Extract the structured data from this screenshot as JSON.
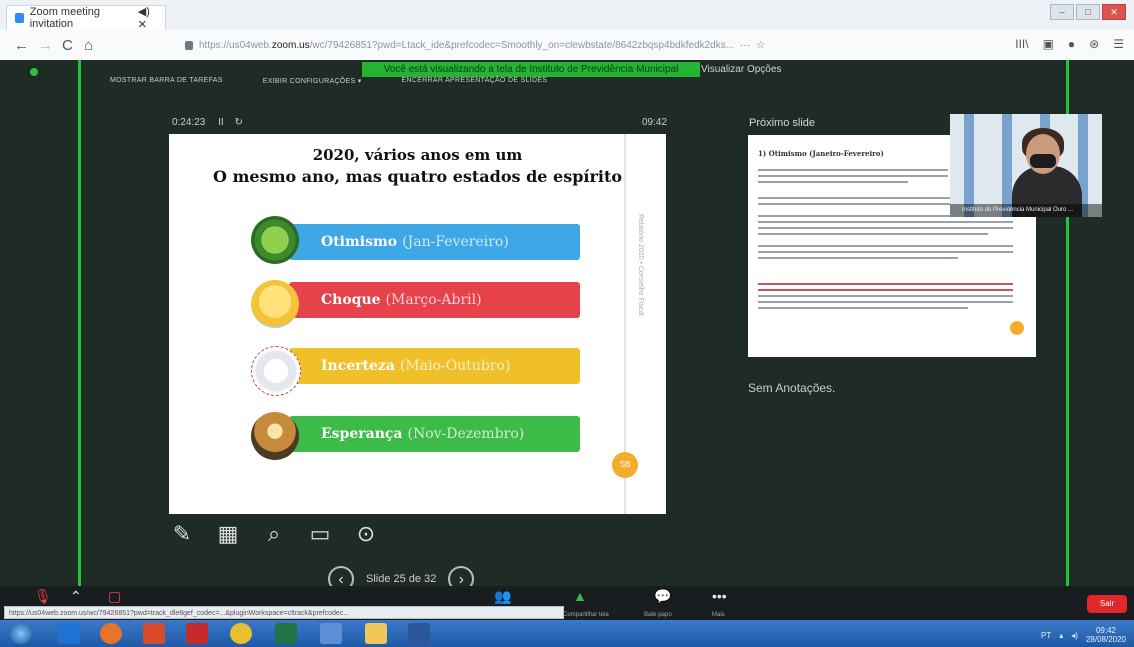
{
  "browser": {
    "tab_title": "Zoom meeting invitation",
    "tab_close": "◀) ✕",
    "window_controls": [
      "–",
      "□",
      "✕"
    ],
    "back": "←",
    "forward": "→",
    "reload": "C",
    "home": "⌂",
    "url_prefix": "https://us04web.",
    "url_domain": "zoom.us",
    "url_rest": "/wc/79426851?pwd=Ltack_ide&prefcodec=Smoothly_on=clewbstate/8642zbqsp4bdkfedk2dks...",
    "more": "···",
    "bookmark": "☆",
    "right_icons": [
      "III\\",
      "▣",
      "●",
      "⊛",
      "☰"
    ]
  },
  "zoom": {
    "share_banner": "Você está visualizando a tela de Instituto de Previdência Municipal",
    "view_options": "Visualizar Opções",
    "top_controls": [
      "MOSTRAR BARRA DE TAREFAS",
      "EXIBIR CONFIGURAÇÕES ▾",
      "ENCERRAR APRESENTAÇÃO DE SLIDES"
    ],
    "elapsed_time": "0:24:23",
    "pause": "II",
    "restart": "↻",
    "clock": "09:42",
    "next_slide_label": "Próximo slide",
    "notes": "Sem Anotações.",
    "slide_counter": "Slide 25 de 32",
    "video_name": "Instituto de Previdência Municipal Ouro ..."
  },
  "slide": {
    "title_line1": "2020, vários anos em um",
    "title_line2": "O mesmo ano, mas quatro estados de espírito",
    "items": [
      {
        "label": "Otimismo",
        "period": "(Jan-Fevereiro)",
        "color": "#3ea7e6"
      },
      {
        "label": "Choque",
        "period": "(Março-Abril)",
        "color": "#e6424c"
      },
      {
        "label": "Incerteza",
        "period": "(Maio-Outubro)",
        "color": "#f0c02a"
      },
      {
        "label": "Esperança",
        "period": "(Nov-Dezembro)",
        "color": "#3dbb48"
      }
    ],
    "badge": "SB",
    "side_text": "Relatório 2020 • Conselho Fiscal"
  },
  "next_slide": {
    "title": "1) Otimismo (Janeiro-Fevereiro)"
  },
  "bottom_bar": {
    "items": [
      "Participantes",
      "Compartilhar tela",
      "Bate-papo",
      "Mais"
    ],
    "exit": "Sair",
    "status_url": "https://us04web.zoom.us/wc/79426851?pwd=track_dle8gef_codec=...&pluginWorkspace=cltrack&prefcodec..."
  },
  "taskbar": {
    "time": "09:42",
    "date": "28/08/2020",
    "tray_label": "PT"
  }
}
